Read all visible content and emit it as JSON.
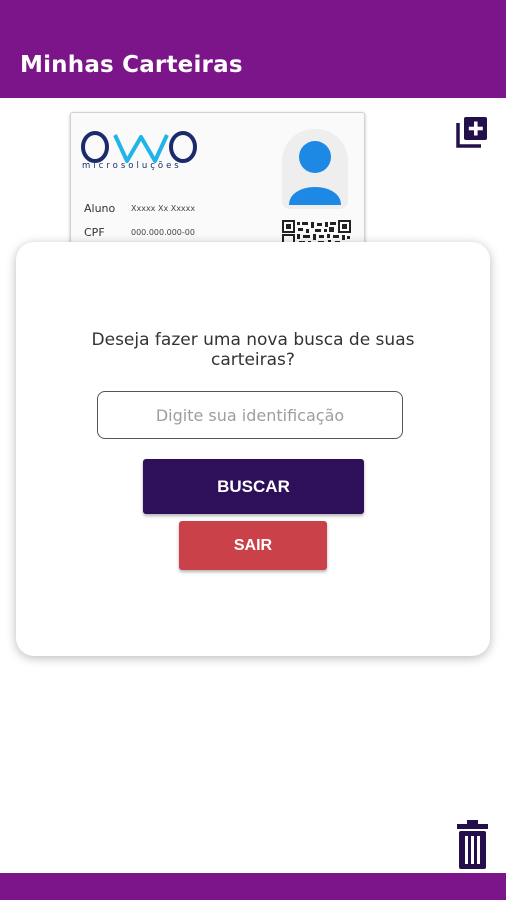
{
  "app_bar": {
    "title": "Minhas Carteiras",
    "background_color": "#7b1589"
  },
  "toolbar": {
    "add_icon": "add-to-library-icon",
    "delete_icon": "trash-icon"
  },
  "card": {
    "logo_text": "owo",
    "logo_subtitle": "microsoluções",
    "student_label": "Aluno",
    "student_value": "Xxxxx Xx Xxxxx",
    "cpf_label": "CPF",
    "cpf_value": "000.000.000-00",
    "photo_icon": "user-avatar-icon",
    "qr_icon": "qr-code-icon"
  },
  "dialog": {
    "prompt_line1": "Deseja fazer uma nova busca de suas",
    "prompt_line2": "carteiras?",
    "input_value": "",
    "input_placeholder": "Digite sua identificação",
    "search_button": "BUSCAR",
    "exit_button": "SAIR"
  },
  "colors": {
    "accent": "#7b1589",
    "primary_button": "#2d0f5a",
    "danger_button": "#cb414a",
    "icon_color": "#23104a"
  }
}
